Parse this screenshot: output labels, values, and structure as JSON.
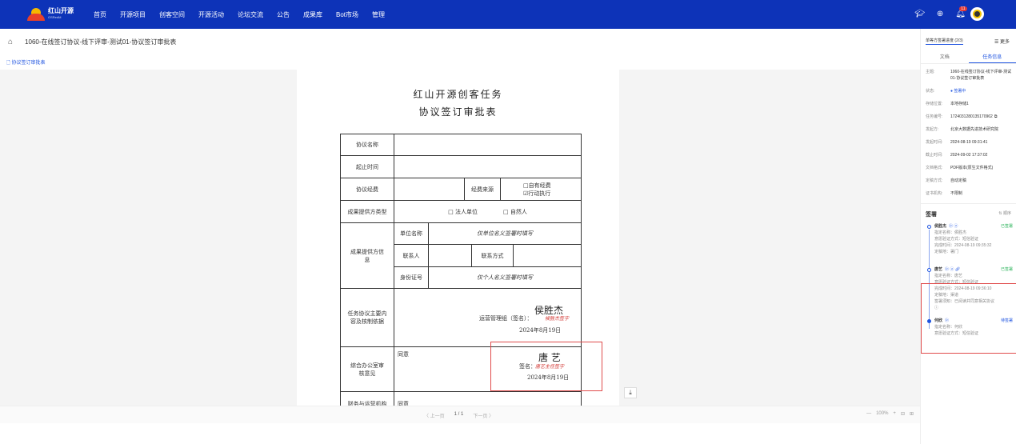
{
  "header": {
    "logo_line1": "红山开源",
    "logo_line2": "OSRedM",
    "nav": [
      "首页",
      "开源项目",
      "创客空间",
      "开源活动",
      "论坛交流",
      "公告",
      "成果库",
      "Bot市场",
      "管理"
    ],
    "notif_count": "11"
  },
  "crumb": {
    "title": "1060-在线签订协议-线下评审-测试01-协议签订审批表"
  },
  "subtab": "协议签订审批表",
  "doc": {
    "title1": "红山开源创客任务",
    "title2": "协议签订审批表",
    "rows": {
      "name_label": "协议名称",
      "period_label": "起止时间",
      "fund_label": "协议经费",
      "fund_source_label": "经费来源",
      "fund_opt1": "□自有经费",
      "fund_opt2": "☑行动执行",
      "type_label": "成果提供方类型",
      "type_opt1": "□ 法人单位",
      "type_opt2": "□ 自然人",
      "provider_label": "成果提供方信息",
      "unit_label": "单位名称",
      "unit_hint": "仅单位名义签署时填写",
      "contact_label": "联系人",
      "contact_way_label": "联系方式",
      "id_label": "身份证号",
      "id_hint": "仅个人名义签署时填写",
      "content_label": "任务协议主要内容及核制依据",
      "ops_sign_label": "运营管理组（签名）：",
      "ops_sign_red": "候胜杰签字",
      "ops_sign_hand": "侯胜杰",
      "ops_date": "2024年8月19日",
      "office_label": "综合办公室审核意见",
      "office_agree": "同意",
      "office_sign_label": "签名：",
      "office_sign_red": "唐艺主任签字",
      "office_sign_hand": "唐 艺",
      "office_date": "2024年8月19日",
      "finance_label": "财务与运营机构",
      "finance_agree": "同意"
    }
  },
  "pager": {
    "prev": "〈 上一页",
    "page": "1 / 1",
    "next": "下一页 〉",
    "zoom_out": "—",
    "zoom": "100%",
    "zoom_in": "+"
  },
  "side": {
    "tab_selected": "单等方签署进度 (2/3)",
    "more": "☰ 更多",
    "tabs": [
      "文档",
      "任务信息"
    ],
    "info": [
      {
        "k": "主题:",
        "v": "1060-在线签订协议-线下评审-测试01-协议签订审批表"
      },
      {
        "k": "状态:",
        "v": "● 签署中"
      },
      {
        "k": "存储位置:",
        "v": "本地存储1"
      },
      {
        "k": "任务编号:",
        "v": "1724031280135170962"
      },
      {
        "k": "发起方:",
        "v": "北京大数据先进技术研究院"
      },
      {
        "k": "发起时间:",
        "v": "2024-08-19 09:31:41"
      },
      {
        "k": "截止时间:",
        "v": "2024-09-02 17:37:02"
      },
      {
        "k": "文档格式:",
        "v": "PDF版本(原生文件格式)"
      },
      {
        "k": "定稿方式:",
        "v": "自动定稿"
      },
      {
        "k": "证书机构:",
        "v": "不限制"
      }
    ],
    "signers_title": "签署",
    "sort": "⇅ 顺序",
    "signers": [
      {
        "name": "侯胜杰",
        "status": "已签署",
        "lines": [
          "指定名称：侯胜杰",
          "意愿验证方式：短信验证",
          "完成时间：2024-08-19 09:35:32",
          "定稿地：署门"
        ]
      },
      {
        "name": "唐艺",
        "status": "已签署",
        "lines": [
          "指定名称：唐艺",
          "意愿验证方式：短信验证",
          "完成时间：2024-08-19 09:36:10",
          "定稿地：渠道",
          "签署须知：已阅读并同意相关协议"
        ]
      },
      {
        "name": "何欣",
        "status": "待签署",
        "lines": [
          "指定名称：何欣",
          "意愿验证方式：短信验证"
        ]
      }
    ]
  }
}
